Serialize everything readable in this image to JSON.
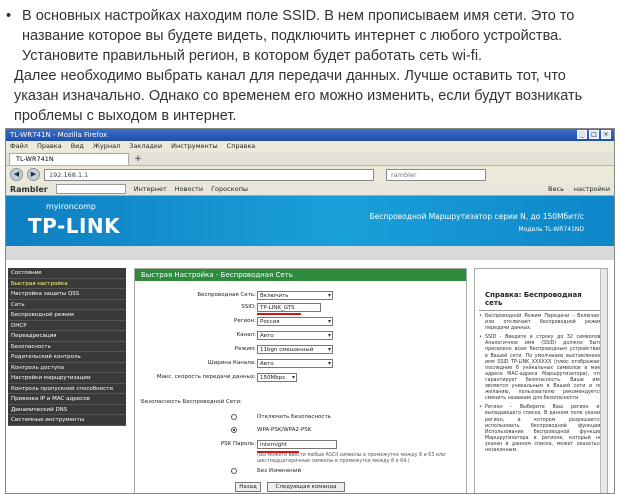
{
  "article": {
    "line1": "В основных настройках находим поле SSID. В нем прописываем имя сети. Это то название которое вы будете видеть, подключить интернет с любого устройства. Установите правильный регион, в котором будет работать сеть wi-fi.",
    "line2": "Далее необходимо выбрать канал для передачи данных. Лучше оставить тот, что указан изначально. Однако со временем его можно изменить, если будут возникать проблемы с выходом в интернет."
  },
  "browser": {
    "title": "TL-WR741N - Mozilla Firefox",
    "menu": [
      "Файл",
      "Правка",
      "Вид",
      "Журнал",
      "Закладки",
      "Инструменты",
      "Справка"
    ],
    "tab_label": "TL-WR741N",
    "new_tab": "+",
    "url": "192.168.1.1",
    "search_placeholder": "rambler",
    "back": "◀",
    "forward": "▶",
    "rambler": {
      "logo": "Rambler",
      "links": [
        "Интернет",
        "Новости",
        "Гороскопы"
      ],
      "right_links": [
        "Весь",
        "настройки"
      ]
    }
  },
  "router": {
    "brand_small": "myironcomp",
    "brand": "TP-LINK",
    "header_right": "Беспроводной Маршрутизатор серии N, до 150Мбит/с",
    "header_model": "Модель TL-WR741ND",
    "sidebar": [
      "Состояние",
      "Быстрая настройка",
      "Настройка защиты QSS",
      "Сеть",
      "Беспроводной режим",
      "DHCP",
      "Переадресация",
      "Безопасность",
      "Родительский контроль",
      "Контроль доступа",
      "Настройки маршрутизации",
      "Контроль пропускной способности",
      "Привязка IP и MAC адресов",
      "Динамический DNS",
      "Системные инструменты"
    ],
    "active_item_index": 1,
    "main_title": "Быстрая Настройка - Беспроводная Сеть",
    "fields": {
      "wireless_label": "Беспроводная Сеть:",
      "wireless_value": "Включить",
      "ssid_label": "SSID:",
      "ssid_value": "TP-LINK_GTS",
      "region_label": "Регион:",
      "region_value": "Россия",
      "channel_label": "Канал:",
      "channel_value": "Авто",
      "mode_label": "Режим:",
      "mode_value": "11bgn смешанный",
      "width_label": "Ширина Канала:",
      "width_value": "Авто",
      "rate_label": "Макс. скорость передачи данных:",
      "rate_value": "150Mbps",
      "security_label": "Безопасность Беспроводной Сети:",
      "sec_off": "Отключить Безопасность",
      "sec_wpa": "WPA-PSK/WPA2-PSK",
      "psk_label": "PSK Пароль:",
      "psk_value": "internight",
      "psk_note": "(Вы можете ввести любые ASCII символы в промежутке между 8 и 63 или шестнадцатеричные символы в промежутке между 8 и 64.)",
      "no_change": "Без Изменений"
    },
    "buttons": {
      "back": "Назад",
      "next": "Следующая команда"
    },
    "help": {
      "title": "Справка: Беспроводная сеть",
      "p1": "Беспроводной Режим Передачи - Включает или отключает беспроводной режим передачи данных.",
      "p2": "SSID - Введите в строку до 32 символов. Аналогичное имя (SSID) должно быть присвоено всем беспроводным устройствам в Вашей сети. По умолчанию выставленное имя SSID TP-LINK_XXXXXX (плюс отображает последние 6 уникальных символов в мак-адресе МАС-адреса Маршрутизатора), что гарантирует безопасность. Ваше имя является уникальным в Вашей сети и по желанию, пользователю рекомендуется сменить название для безопасности.",
      "p3": "Регион - Выберите Ваш регион из выпадающего списка. В данном поле указан регион, в котором разрешается использовать беспроводной функции. Использование беспроводной функции Маршрутизатора в регионе, который не указан в данном списке, может оказаться незаконным."
    }
  }
}
